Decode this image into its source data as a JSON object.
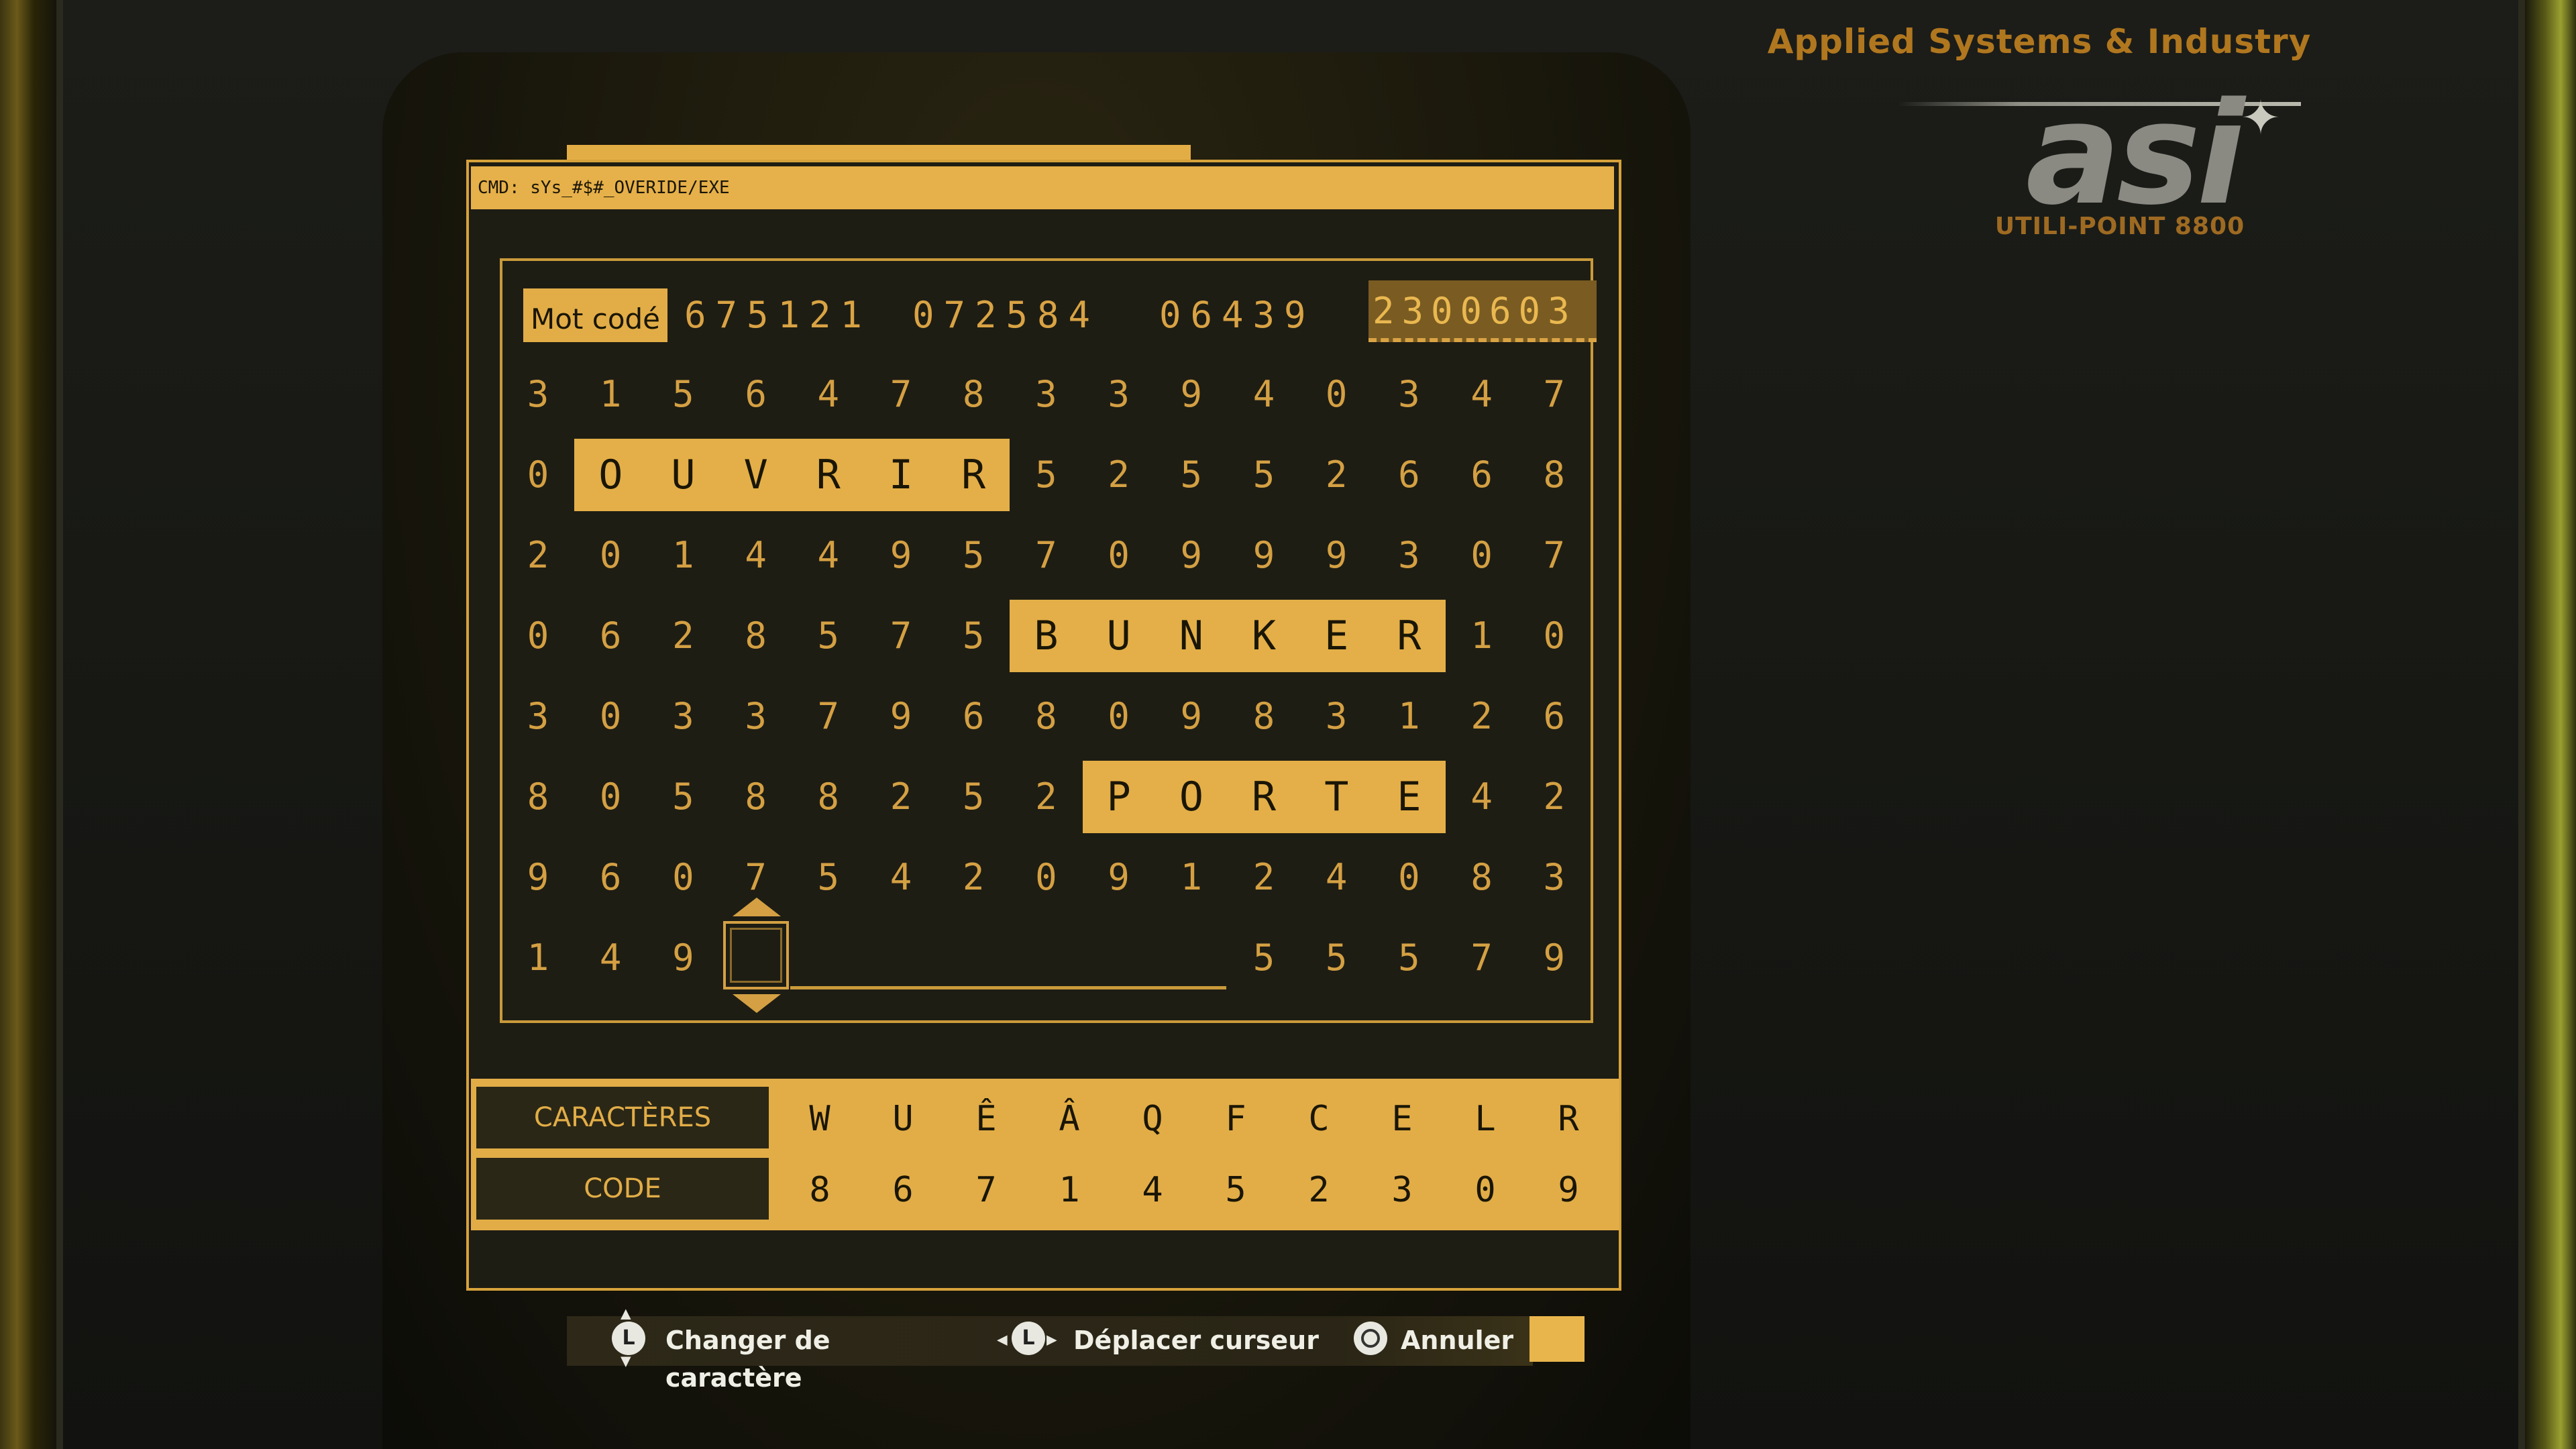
{
  "brand": {
    "company": "Applied Systems & Industry",
    "logo": "asi",
    "model": "UTILI-POINT 8800"
  },
  "terminal": {
    "cmd": "CMD: sYs_#$#_OVERIDE/EXE"
  },
  "code_row": {
    "label": "Mot codé",
    "groups": [
      "675121",
      "072584",
      "06439"
    ],
    "target": "2300603"
  },
  "grid": {
    "rows": [
      [
        "3",
        "1",
        "5",
        "6",
        "4",
        "7",
        "8",
        "3",
        "3",
        "9",
        "4",
        "0",
        "3",
        "4",
        "7"
      ],
      [
        "0",
        "",
        "",
        "",
        "",
        "",
        "",
        "5",
        "2",
        "5",
        "5",
        "2",
        "6",
        "6",
        "8"
      ],
      [
        "2",
        "0",
        "1",
        "4",
        "4",
        "9",
        "5",
        "7",
        "0",
        "9",
        "9",
        "9",
        "3",
        "0",
        "7"
      ],
      [
        "0",
        "6",
        "2",
        "8",
        "5",
        "7",
        "5",
        "",
        "",
        "",
        "",
        "",
        "",
        "1",
        "0"
      ],
      [
        "3",
        "0",
        "3",
        "3",
        "7",
        "9",
        "6",
        "8",
        "0",
        "9",
        "8",
        "3",
        "1",
        "2",
        "6"
      ],
      [
        "8",
        "0",
        "5",
        "8",
        "8",
        "2",
        "5",
        "2",
        "",
        "",
        "",
        "",
        "",
        "4",
        "2"
      ],
      [
        "9",
        "6",
        "0",
        "7",
        "5",
        "4",
        "2",
        "0",
        "9",
        "1",
        "2",
        "4",
        "0",
        "8",
        "3"
      ],
      [
        "1",
        "4",
        "9",
        "",
        "",
        "",
        "",
        "",
        "",
        "",
        "5",
        "5",
        "5",
        "7",
        "9"
      ]
    ],
    "words": [
      {
        "row": 1,
        "col": 1,
        "letters": [
          "O",
          "U",
          "V",
          "R",
          "I",
          "R"
        ]
      },
      {
        "row": 3,
        "col": 7,
        "letters": [
          "B",
          "U",
          "N",
          "K",
          "E",
          "R"
        ]
      },
      {
        "row": 5,
        "col": 8,
        "letters": [
          "P",
          "O",
          "R",
          "T",
          "E"
        ]
      }
    ]
  },
  "legend": {
    "chars_label": "CARACTÈRES",
    "code_label": "CODE",
    "chars": [
      "W",
      "U",
      "Ê",
      "Â",
      "Q",
      "F",
      "C",
      "E",
      "L",
      "R"
    ],
    "codes": [
      "8",
      "6",
      "7",
      "1",
      "4",
      "5",
      "2",
      "3",
      "0",
      "9"
    ]
  },
  "hints": {
    "change_char_button": "L",
    "change_char": "Changer de caractère",
    "move_cursor_button": "L",
    "move_cursor": "Déplacer curseur",
    "cancel": "Annuler"
  }
}
